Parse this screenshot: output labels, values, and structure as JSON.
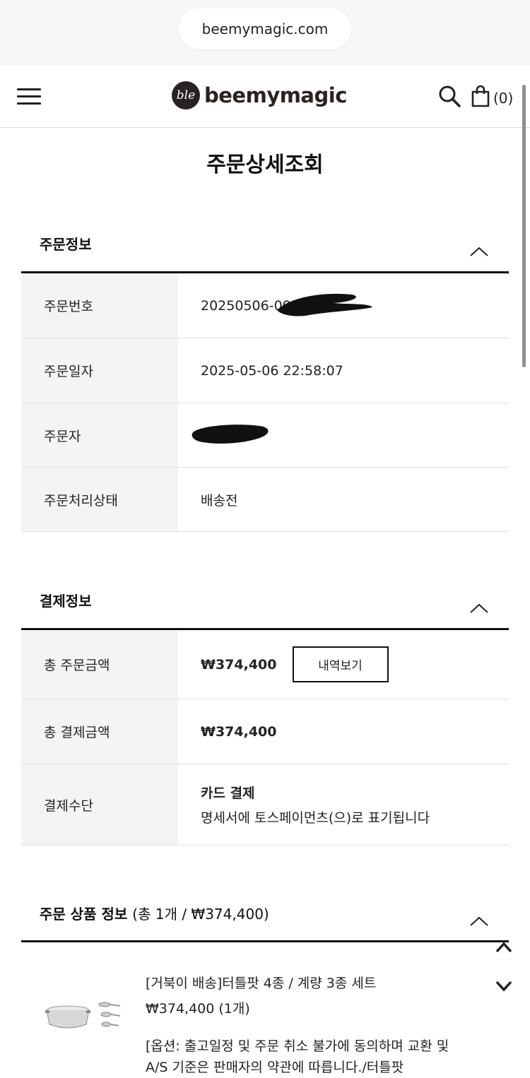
{
  "browser": {
    "url": "beemymagic.com"
  },
  "header": {
    "logo_mark": "ble",
    "logo_text": "beemymagic",
    "cart_count": "(0)",
    "icons": [
      "menu-icon",
      "search-icon",
      "cart-icon"
    ]
  },
  "page_title": "주문상세조회",
  "order_info": {
    "title": "주문정보",
    "rows": [
      {
        "label": "주문번호",
        "value": "20250506-000"
      },
      {
        "label": "주문일자",
        "value": "2025-05-06 22:58:07"
      },
      {
        "label": "주문자",
        "value": ""
      },
      {
        "label": "주문처리상태",
        "value": "배송전"
      }
    ]
  },
  "payment_info": {
    "title": "결제정보",
    "total_order_label": "총 주문금액",
    "total_order_value": "₩374,400",
    "detail_button": "내역보기",
    "total_paid_label": "총 결제금액",
    "total_paid_value": "₩374,400",
    "method_label": "결제수단",
    "method_value": "카드 결제",
    "method_note": "명세서에 토스페이먼츠(으)로 표기됩니다"
  },
  "products": {
    "title": "주문 상품 정보",
    "summary": "(총 1개 / ₩374,400)",
    "items": [
      {
        "name": "[거북이 배송]터틀팟 4종 / 계량 3종 세트",
        "price": "₩374,400 (1개)",
        "option": "[옵션: 출고일정 및 주문 취소 불가에 동의하며 교환 및 A/S 기준은 판매자의 약관에 따릅니다./터틀팟"
      }
    ]
  }
}
